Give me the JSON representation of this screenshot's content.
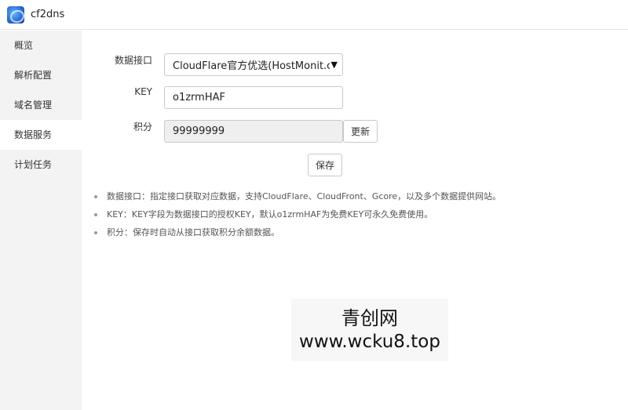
{
  "app": {
    "title": "cf2dns"
  },
  "sidebar": {
    "items": [
      {
        "label": "概览"
      },
      {
        "label": "解析配置"
      },
      {
        "label": "域名管理"
      },
      {
        "label": "数据服务"
      },
      {
        "label": "计划任务"
      }
    ],
    "active_index": 3
  },
  "form": {
    "api": {
      "label": "数据接口",
      "value": "CloudFlare官方优选(HostMonit.co"
    },
    "key": {
      "label": "KEY",
      "value": "o1zrmHAF"
    },
    "points": {
      "label": "积分",
      "value": "99999999",
      "update_label": "更新"
    },
    "save_label": "保存"
  },
  "tips": [
    "数据接口：指定接口获取对应数据，支持CloudFlare、CloudFront、Gcore，以及多个数据提供网站。",
    "KEY：KEY字段为数据接口的授权KEY，默认o1zrmHAF为免费KEY可永久免费使用。",
    "积分：保存时自动从接口获取积分余额数据。"
  ],
  "watermark": {
    "line1": "青创网",
    "line2": "www.wcku8.top"
  }
}
